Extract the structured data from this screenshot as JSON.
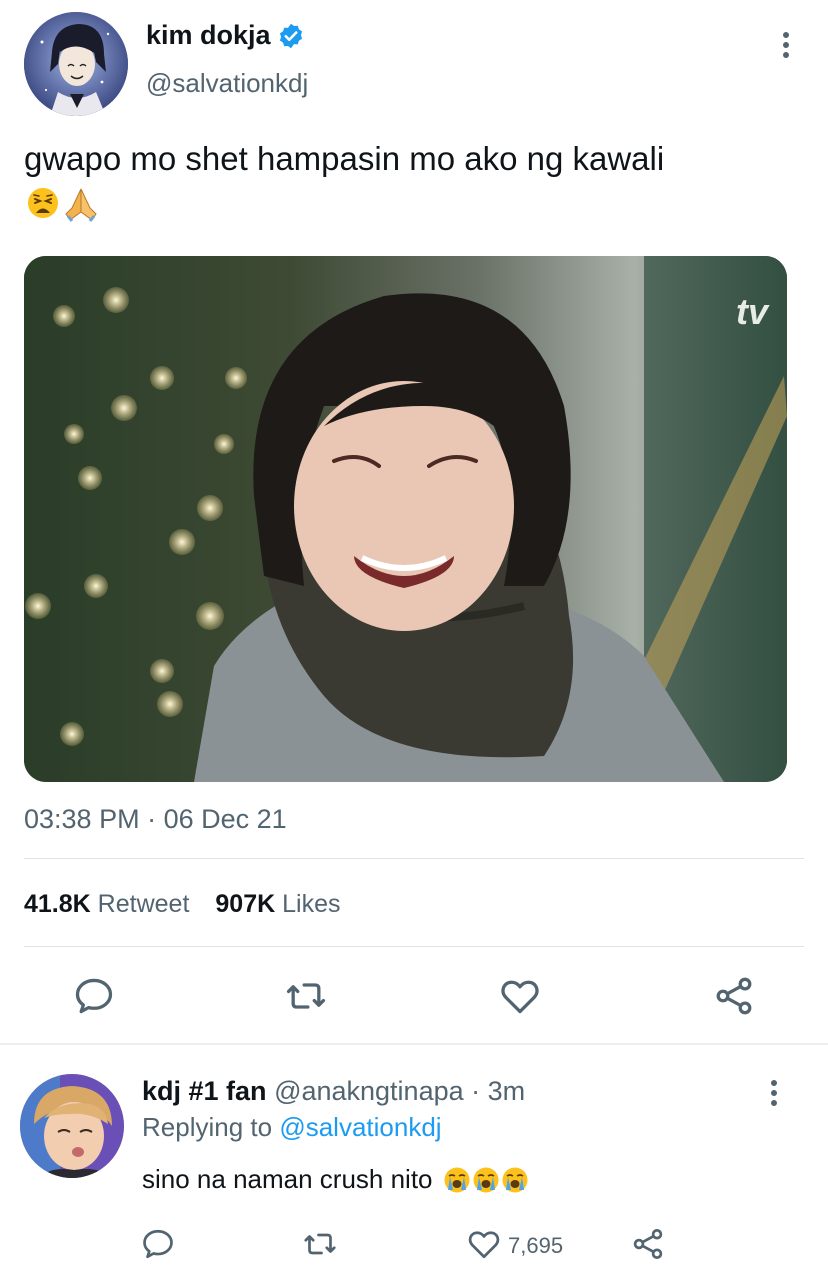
{
  "tweet": {
    "display_name": "kim dokja",
    "handle": "@salvationkdj",
    "text": "gwapo mo shet hampasin mo ako ng kawali",
    "emojis": [
      "weary-face",
      "folded-hands"
    ],
    "media_watermark": "tv",
    "time": "03:38 PM",
    "date": "06 Dec 21",
    "time_sep": "·",
    "retweet_count": "41.8K",
    "retweet_label": "Retweet",
    "like_count": "907K",
    "like_label": "Likes",
    "actions": [
      "reply-icon",
      "retweet-icon",
      "heart-icon",
      "share-icon"
    ]
  },
  "reply": {
    "display_name": "kdj #1 fan",
    "handle": "@anakngtinapa",
    "sep": "·",
    "age": "3m",
    "replying_label": "Replying to",
    "replying_to": "@salvationkdj",
    "text": "sino na naman crush nito",
    "emojis": [
      "loudly-crying-face",
      "loudly-crying-face",
      "loudly-crying-face"
    ],
    "like_count": "7,695",
    "actions": [
      "reply-icon",
      "retweet-icon",
      "heart-icon",
      "share-icon"
    ]
  },
  "colors": {
    "text": "#0f1419",
    "secondary": "#536471",
    "link": "#1d9bf0",
    "divider": "#dfe3e6"
  }
}
